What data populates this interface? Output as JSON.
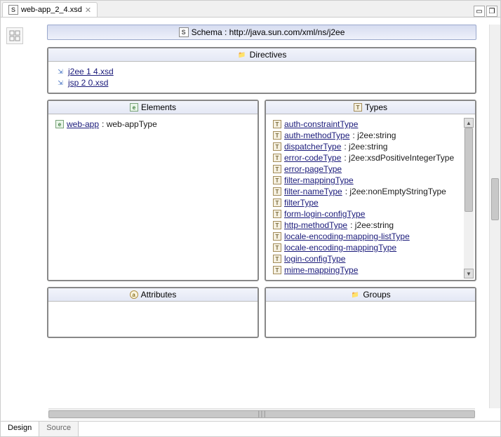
{
  "tab": {
    "filename": "web-app_2_4.xsd"
  },
  "schema": {
    "label": "Schema : http://java.sun.com/xml/ns/j2ee"
  },
  "panels": {
    "directives": {
      "title": "Directives",
      "items": [
        {
          "name": "j2ee 1 4.xsd"
        },
        {
          "name": "jsp 2 0.xsd"
        }
      ]
    },
    "elements": {
      "title": "Elements",
      "items": [
        {
          "name": "web-app",
          "suffix": " : web-appType"
        }
      ]
    },
    "types": {
      "title": "Types",
      "items": [
        {
          "name": "auth-constraintType",
          "suffix": ""
        },
        {
          "name": "auth-methodType",
          "suffix": " : j2ee:string"
        },
        {
          "name": "dispatcherType",
          "suffix": " : j2ee:string"
        },
        {
          "name": "error-codeType",
          "suffix": " : j2ee:xsdPositiveIntegerType"
        },
        {
          "name": "error-pageType",
          "suffix": ""
        },
        {
          "name": "filter-mappingType",
          "suffix": ""
        },
        {
          "name": "filter-nameType",
          "suffix": " : j2ee:nonEmptyStringType"
        },
        {
          "name": "filterType",
          "suffix": ""
        },
        {
          "name": "form-login-configType",
          "suffix": ""
        },
        {
          "name": "http-methodType",
          "suffix": " : j2ee:string"
        },
        {
          "name": "locale-encoding-mapping-listType",
          "suffix": ""
        },
        {
          "name": "locale-encoding-mappingType",
          "suffix": ""
        },
        {
          "name": "login-configType",
          "suffix": ""
        },
        {
          "name": "mime-mappingType",
          "suffix": ""
        }
      ]
    },
    "attributes": {
      "title": "Attributes"
    },
    "groups": {
      "title": "Groups"
    }
  },
  "bottomTabs": {
    "design": "Design",
    "source": "Source"
  }
}
